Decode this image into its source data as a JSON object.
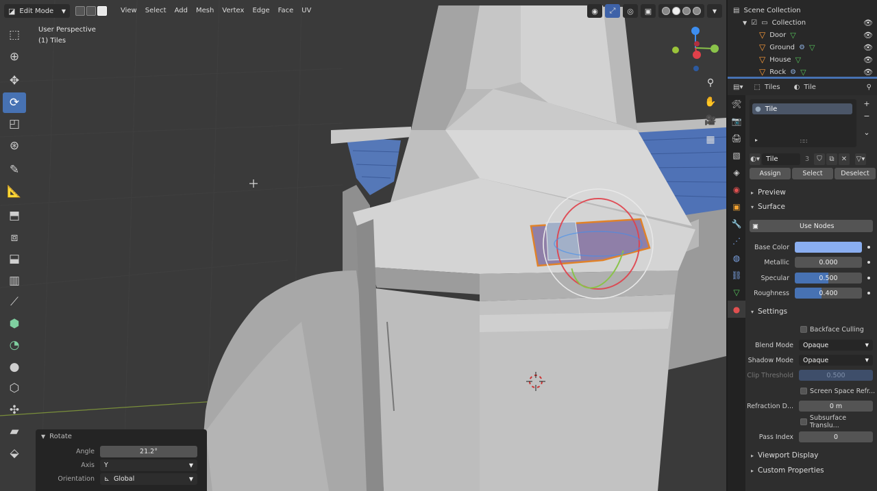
{
  "header": {
    "mode": "Edit Mode",
    "menus": [
      "View",
      "Select",
      "Add",
      "Mesh",
      "Vertex",
      "Edge",
      "Face",
      "UV"
    ]
  },
  "viewport_info": {
    "line1": "User Perspective",
    "line2": "(1) Tiles"
  },
  "tools": [
    "select-box",
    "cursor",
    "move",
    "rotate",
    "scale",
    "transform",
    "annotate",
    "measure",
    "extrude",
    "inset",
    "bevel",
    "loop-cut",
    "knife",
    "poly-build",
    "spin",
    "smooth",
    "edge-slide",
    "shrink-fatten",
    "shear",
    "rip"
  ],
  "active_tool": "rotate",
  "operator_panel": {
    "title": "Rotate",
    "angle_label": "Angle",
    "angle_value": "21.2°",
    "axis_label": "Axis",
    "axis_value": "Y",
    "orientation_label": "Orientation",
    "orientation_value": "Global"
  },
  "outliner": {
    "root": "Scene Collection",
    "collection": "Collection",
    "objects": [
      {
        "name": "Door"
      },
      {
        "name": "Ground"
      },
      {
        "name": "House"
      },
      {
        "name": "Rock"
      }
    ]
  },
  "properties_header": {
    "object": "Tiles",
    "material": "Tile"
  },
  "material": {
    "slot_name": "Tile",
    "name": "Tile",
    "users": "3",
    "assign": "Assign",
    "select": "Select",
    "deselect": "Deselect"
  },
  "sections": {
    "preview": "Preview",
    "surface": "Surface",
    "settings": "Settings",
    "viewport_display": "Viewport Display",
    "custom_properties": "Custom Properties"
  },
  "surface": {
    "use_nodes": "Use Nodes",
    "base_color_label": "Base Color",
    "base_color": "#8aaef0",
    "metallic_label": "Metallic",
    "metallic": "0.000",
    "specular_label": "Specular",
    "specular": "0.500",
    "specular_fraction": 0.5,
    "roughness_label": "Roughness",
    "roughness": "0.400",
    "roughness_fraction": 0.4
  },
  "settings": {
    "backface_culling": "Backface Culling",
    "blend_mode_label": "Blend Mode",
    "blend_mode": "Opaque",
    "shadow_mode_label": "Shadow Mode",
    "shadow_mode": "Opaque",
    "clip_threshold_label": "Clip Threshold",
    "clip_threshold": "0.500",
    "screen_space_refraction": "Screen Space Refr...",
    "refraction_depth_label": "Refraction D...",
    "refraction_depth": "0 m",
    "subsurface_translucency": "Subsurface Translu...",
    "pass_index_label": "Pass Index",
    "pass_index": "0"
  },
  "colors": {
    "accent": "#4772b3",
    "tile_roof": "#5a7fc0",
    "gizmo_red": "#e0404a",
    "gizmo_green": "#8ac34a",
    "gizmo_blue": "#3d8ef0"
  }
}
